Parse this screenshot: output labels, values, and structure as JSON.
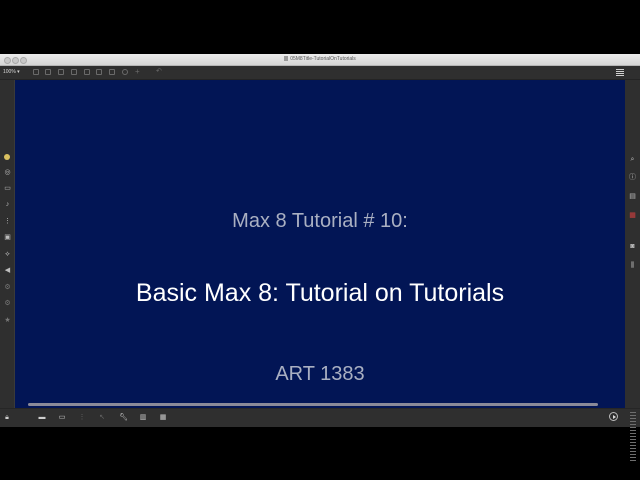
{
  "window": {
    "title": "05M8Title-TutorialOnTutorials"
  },
  "toolbar": {
    "zoom_label": "100%"
  },
  "slide": {
    "line1": "Max 8 Tutorial # 10:",
    "line2": "Basic Max 8: Tutorial on Tutorials",
    "line3": "ART 1383"
  },
  "colors": {
    "canvas_background": "#021555",
    "title_text": "#ffffff",
    "subtitle_text": "#aab0c2"
  },
  "left_sidebar_icons": [
    "object-icon",
    "circle-icon",
    "message-icon",
    "music-note-icon",
    "matrix-icon",
    "image-icon",
    "link-icon",
    "arrow-icon",
    "settings-icon",
    "settings-icon",
    "star-icon"
  ],
  "right_sidebar_icons": [
    "search-icon",
    "info-icon",
    "book-icon",
    "inspector-icon",
    "camera-icon",
    "levels-icon"
  ],
  "bottom_toolbar_icons": [
    "lock-icon",
    "comment-icon",
    "layers-icon",
    "grid-icon",
    "pointer-icon",
    "wrench-icon",
    "piano-icon",
    "keyboard-icon"
  ]
}
